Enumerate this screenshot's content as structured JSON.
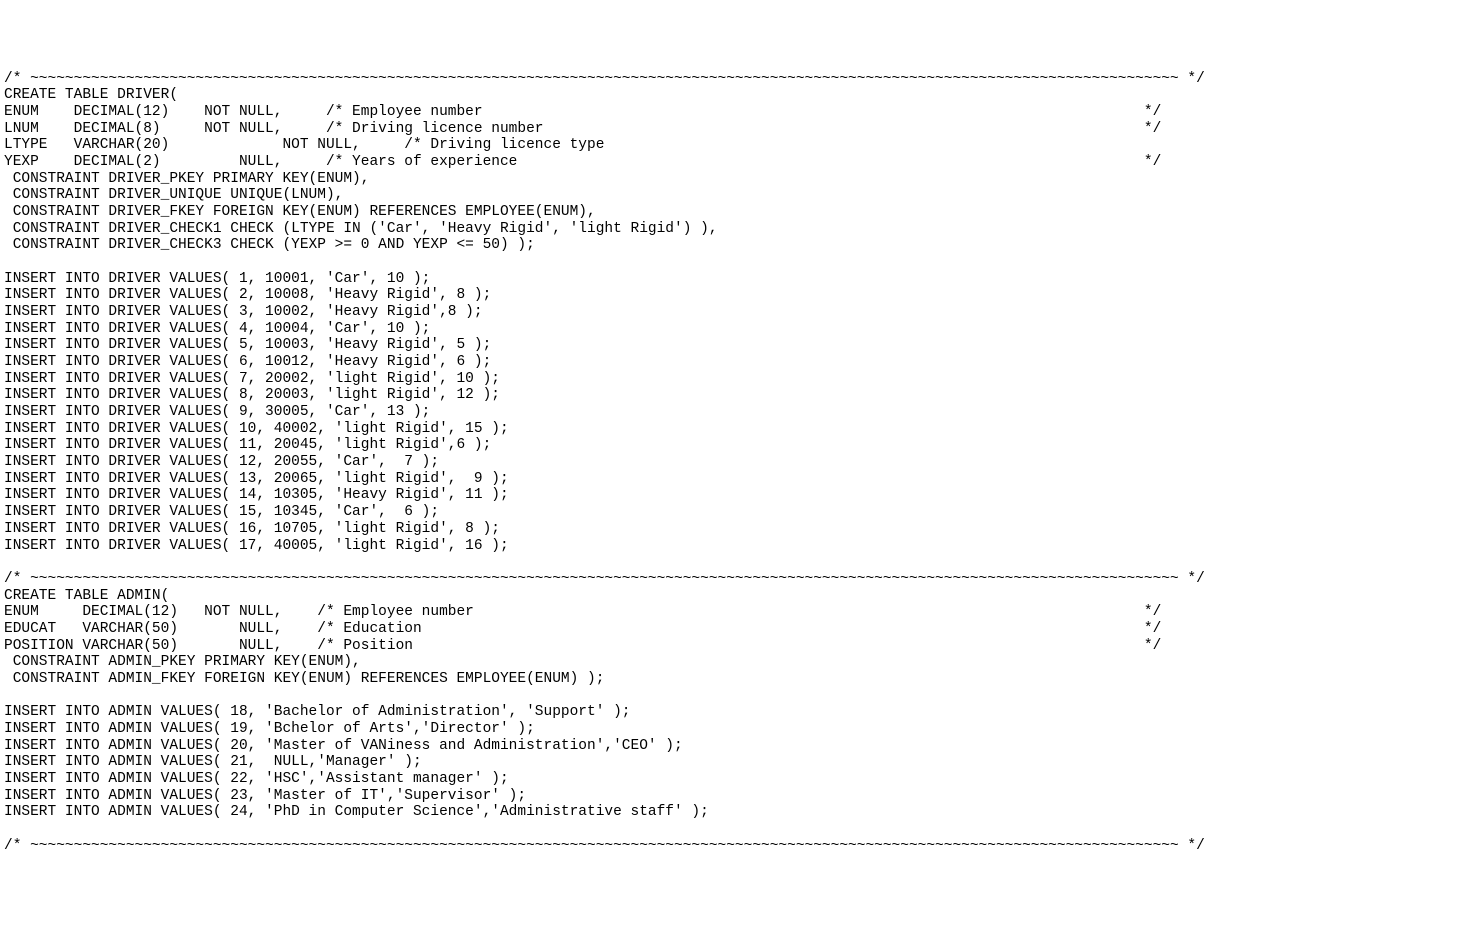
{
  "lines": [
    "/* ~~~~~~~~~~~~~~~~~~~~~~~~~~~~~~~~~~~~~~~~~~~~~~~~~~~~~~~~~~~~~~~~~~~~~~~~~~~~~~~~~~~~~~~~~~~~~~~~~~~~~~~~~~~~~~~~~~~~~~~~~~~~~~~~~~~~ */",
    "CREATE TABLE DRIVER(",
    "ENUM    DECIMAL(12)    NOT NULL,     /* Employee number                                                                            */",
    "LNUM    DECIMAL(8)     NOT NULL,     /* Driving licence number                                                                     */",
    "LTYPE   VARCHAR(20)             NOT NULL,     /* Driving licence type",
    "YEXP    DECIMAL(2)         NULL,     /* Years of experience                                                                        */",
    " CONSTRAINT DRIVER_PKEY PRIMARY KEY(ENUM),",
    " CONSTRAINT DRIVER_UNIQUE UNIQUE(LNUM),",
    " CONSTRAINT DRIVER_FKEY FOREIGN KEY(ENUM) REFERENCES EMPLOYEE(ENUM),",
    " CONSTRAINT DRIVER_CHECK1 CHECK (LTYPE IN ('Car', 'Heavy Rigid', 'light Rigid') ),",
    " CONSTRAINT DRIVER_CHECK3 CHECK (YEXP >= 0 AND YEXP <= 50) );",
    "",
    "INSERT INTO DRIVER VALUES( 1, 10001, 'Car', 10 );",
    "INSERT INTO DRIVER VALUES( 2, 10008, 'Heavy Rigid', 8 );",
    "INSERT INTO DRIVER VALUES( 3, 10002, 'Heavy Rigid',8 );",
    "INSERT INTO DRIVER VALUES( 4, 10004, 'Car', 10 );",
    "INSERT INTO DRIVER VALUES( 5, 10003, 'Heavy Rigid', 5 );",
    "INSERT INTO DRIVER VALUES( 6, 10012, 'Heavy Rigid', 6 );",
    "INSERT INTO DRIVER VALUES( 7, 20002, 'light Rigid', 10 );",
    "INSERT INTO DRIVER VALUES( 8, 20003, 'light Rigid', 12 );",
    "INSERT INTO DRIVER VALUES( 9, 30005, 'Car', 13 );",
    "INSERT INTO DRIVER VALUES( 10, 40002, 'light Rigid', 15 );",
    "INSERT INTO DRIVER VALUES( 11, 20045, 'light Rigid',6 );",
    "INSERT INTO DRIVER VALUES( 12, 20055, 'Car',  7 );",
    "INSERT INTO DRIVER VALUES( 13, 20065, 'light Rigid',  9 );",
    "INSERT INTO DRIVER VALUES( 14, 10305, 'Heavy Rigid', 11 );",
    "INSERT INTO DRIVER VALUES( 15, 10345, 'Car',  6 );",
    "INSERT INTO DRIVER VALUES( 16, 10705, 'light Rigid', 8 );",
    "INSERT INTO DRIVER VALUES( 17, 40005, 'light Rigid', 16 );",
    "",
    "/* ~~~~~~~~~~~~~~~~~~~~~~~~~~~~~~~~~~~~~~~~~~~~~~~~~~~~~~~~~~~~~~~~~~~~~~~~~~~~~~~~~~~~~~~~~~~~~~~~~~~~~~~~~~~~~~~~~~~~~~~~~~~~~~~~~~~~ */",
    "CREATE TABLE ADMIN(",
    "ENUM     DECIMAL(12)   NOT NULL,    /* Employee number                                                                             */",
    "EDUCAT   VARCHAR(50)       NULL,    /* Education                                                                                   */",
    "POSITION VARCHAR(50)       NULL,    /* Position                                                                                    */",
    " CONSTRAINT ADMIN_PKEY PRIMARY KEY(ENUM),",
    " CONSTRAINT ADMIN_FKEY FOREIGN KEY(ENUM) REFERENCES EMPLOYEE(ENUM) );",
    "",
    "INSERT INTO ADMIN VALUES( 18, 'Bachelor of Administration', 'Support' );",
    "INSERT INTO ADMIN VALUES( 19, 'Bchelor of Arts','Director' );",
    "INSERT INTO ADMIN VALUES( 20, 'Master of VANiness and Administration','CEO' );",
    "INSERT INTO ADMIN VALUES( 21,  NULL,'Manager' );",
    "INSERT INTO ADMIN VALUES( 22, 'HSC','Assistant manager' );",
    "INSERT INTO ADMIN VALUES( 23, 'Master of IT','Supervisor' );",
    "INSERT INTO ADMIN VALUES( 24, 'PhD in Computer Science','Administrative staff' );",
    "",
    "/* ~~~~~~~~~~~~~~~~~~~~~~~~~~~~~~~~~~~~~~~~~~~~~~~~~~~~~~~~~~~~~~~~~~~~~~~~~~~~~~~~~~~~~~~~~~~~~~~~~~~~~~~~~~~~~~~~~~~~~~~~~~~~~~~~~~~~ */"
  ]
}
